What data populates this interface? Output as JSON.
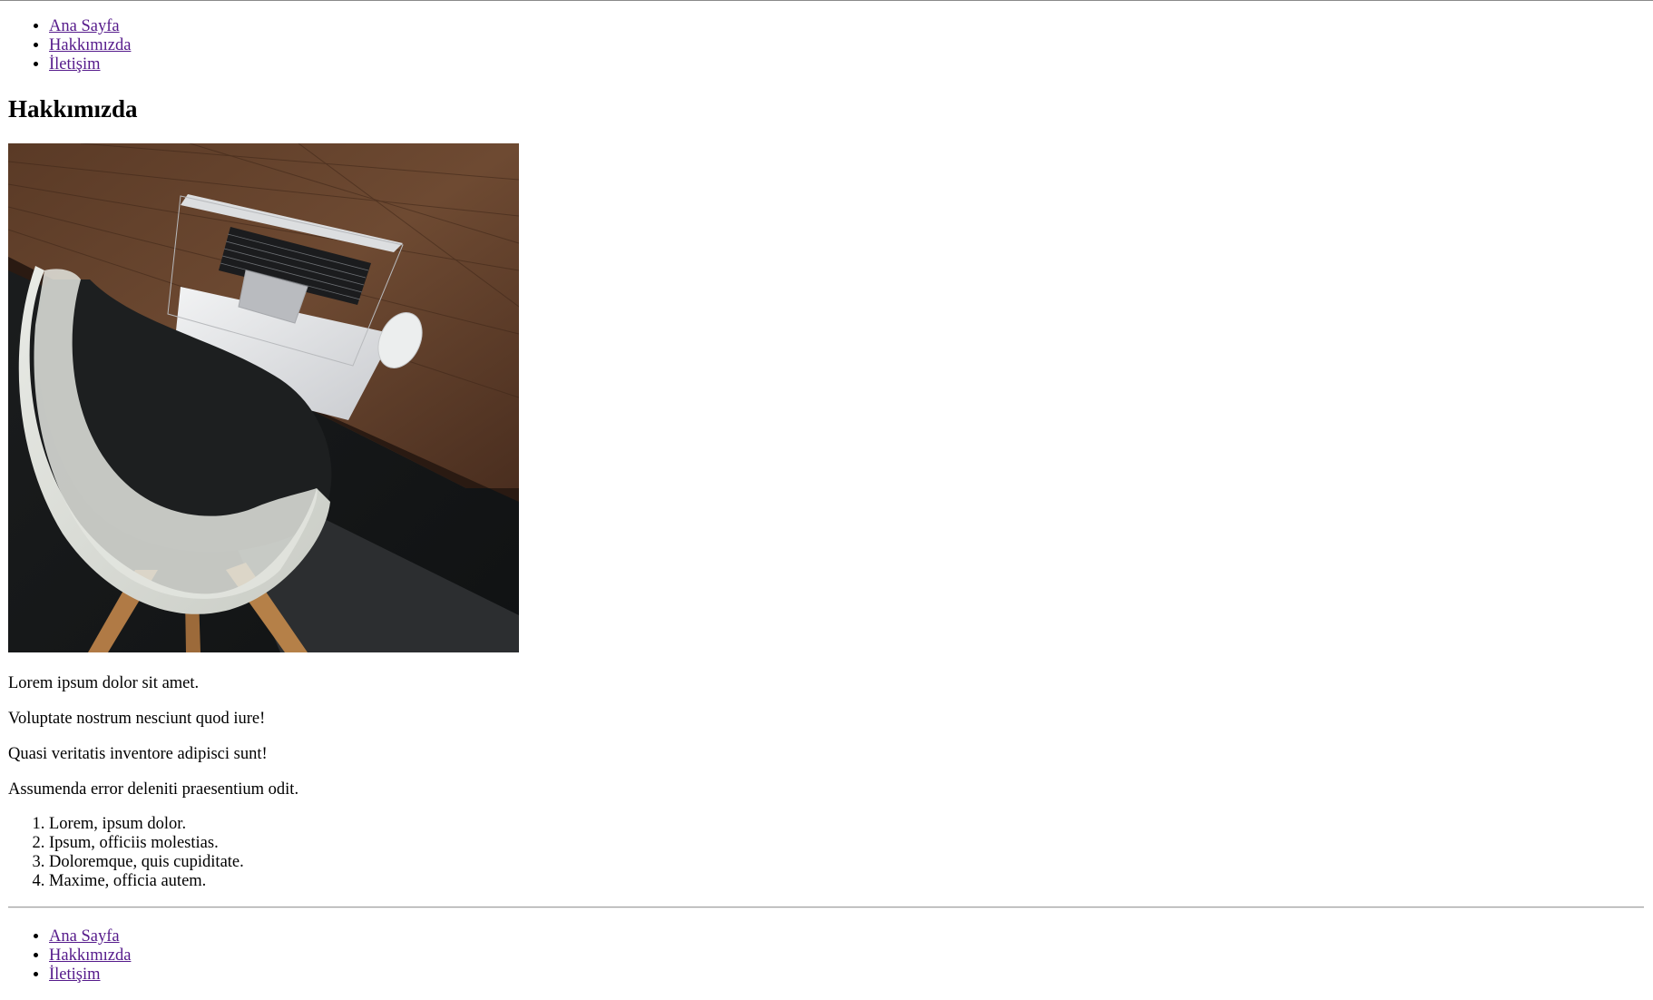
{
  "nav_top": [
    {
      "label": "Ana Sayfa"
    },
    {
      "label": "Hakkımızda"
    },
    {
      "label": "İletişim"
    }
  ],
  "page": {
    "heading": "Hakkımızda"
  },
  "image": {
    "description_icon": "desk-laptop-chair-photo"
  },
  "paragraphs": [
    "Lorem ipsum dolor sit amet.",
    "Voluptate nostrum nesciunt quod iure!",
    "Quasi veritatis inventore adipisci sunt!",
    "Assumenda error deleniti praesentium odit."
  ],
  "ordered_list": [
    "Lorem, ipsum dolor.",
    "Ipsum, officiis molestias.",
    "Doloremque, quis cupiditate.",
    "Maxime, officia autem."
  ],
  "nav_bottom": [
    {
      "label": "Ana Sayfa"
    },
    {
      "label": "Hakkımızda"
    },
    {
      "label": "İletişim"
    }
  ],
  "colors": {
    "link_visited": "#551a8b",
    "text": "#000000",
    "background": "#ffffff"
  }
}
